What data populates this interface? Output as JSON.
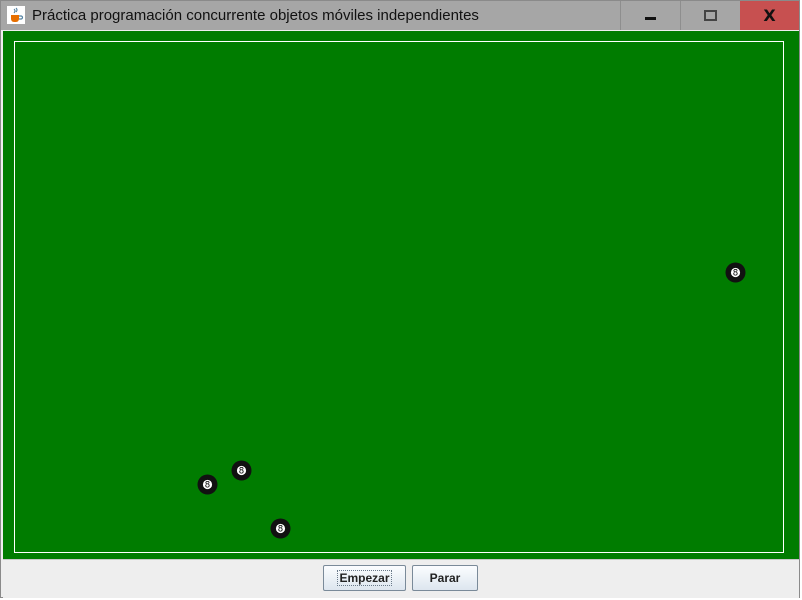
{
  "window": {
    "title": "Práctica programación concurrente objetos móviles independientes",
    "controls": {
      "minimize": "minimize",
      "maximize": "maximize",
      "close": "X"
    }
  },
  "table": {
    "background_color": "#007c00",
    "ball_label": "8",
    "balls": [
      {
        "name": "ball-1",
        "label": "8"
      },
      {
        "name": "ball-2",
        "label": "8"
      },
      {
        "name": "ball-3",
        "label": "8"
      },
      {
        "name": "ball-4",
        "label": "8"
      }
    ]
  },
  "controls": {
    "start_label": "Empezar",
    "stop_label": "Parar"
  },
  "colors": {
    "title_bar": "#a6a6a6",
    "close_button": "#c75050",
    "felt": "#007c00"
  }
}
